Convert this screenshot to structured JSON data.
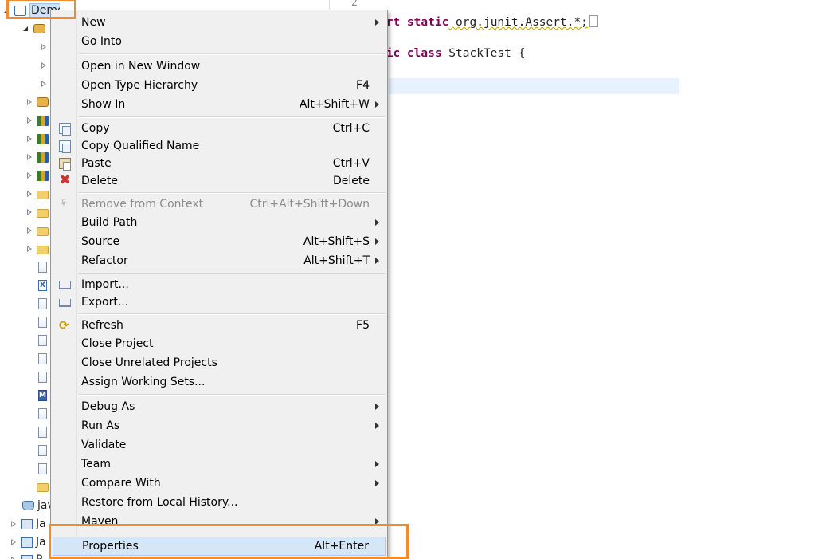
{
  "explorer": {
    "project_label": "Demo",
    "bottom_items": [
      {
        "label": "jav"
      },
      {
        "label": "Ja"
      },
      {
        "label": "Ja"
      },
      {
        "label": "P"
      }
    ]
  },
  "editor": {
    "line_number": "2",
    "line1": {
      "keyword": "ort static",
      "text": " org.junit.Assert.*;"
    },
    "line2": {
      "keyword": "lic class",
      "text": " StackTest {"
    }
  },
  "menu": {
    "new": "New",
    "go_into": "Go Into",
    "open_new_window": "Open in New Window",
    "open_type_hierarchy": {
      "label": "Open Type Hierarchy",
      "shortcut": "F4"
    },
    "show_in": {
      "label": "Show In",
      "shortcut": "Alt+Shift+W"
    },
    "copy": {
      "label": "Copy",
      "shortcut": "Ctrl+C"
    },
    "copy_qualified": "Copy Qualified Name",
    "paste": {
      "label": "Paste",
      "shortcut": "Ctrl+V"
    },
    "delete": {
      "label": "Delete",
      "shortcut": "Delete"
    },
    "remove_context": {
      "label": "Remove from Context",
      "shortcut": "Ctrl+Alt+Shift+Down"
    },
    "build_path": "Build Path",
    "source": {
      "label": "Source",
      "shortcut": "Alt+Shift+S"
    },
    "refactor": {
      "label": "Refactor",
      "shortcut": "Alt+Shift+T"
    },
    "import": "Import...",
    "export": "Export...",
    "refresh": {
      "label": "Refresh",
      "shortcut": "F5"
    },
    "close_project": "Close Project",
    "close_unrelated": "Close Unrelated Projects",
    "assign_working_sets": "Assign Working Sets...",
    "debug_as": "Debug As",
    "run_as": "Run As",
    "validate": "Validate",
    "team": "Team",
    "compare_with": "Compare With",
    "restore_history": "Restore from Local History...",
    "maven": "Maven",
    "properties": {
      "label": "Properties",
      "shortcut": "Alt+Enter"
    }
  },
  "colors": {
    "highlight_box": "#f28a2e",
    "menu_background": "#f0f0f0",
    "selected_item": "#d5e6f7",
    "keyword": "#7f0055"
  }
}
